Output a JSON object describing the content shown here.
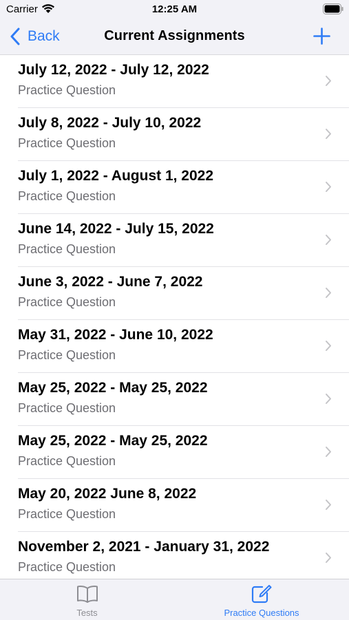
{
  "status_bar": {
    "carrier": "Carrier",
    "time": "12:25 AM",
    "wifi_icon": "wifi-icon",
    "battery_icon": "battery-full-icon"
  },
  "nav": {
    "back_label": "Back",
    "title": "Current Assignments",
    "add_icon": "plus-icon"
  },
  "colors": {
    "accent": "#2f7cf6",
    "secondary_text": "#6d6d72",
    "inactive_tab": "#8e8e93",
    "bar_background": "#f2f2f7"
  },
  "assignments": [
    {
      "title": "July 12, 2022 - July 12, 2022",
      "subtitle": "Practice Question"
    },
    {
      "title": "July 8, 2022 - July 10, 2022",
      "subtitle": "Practice Question"
    },
    {
      "title": "July 1, 2022 - August 1, 2022",
      "subtitle": "Practice Question"
    },
    {
      "title": "June 14, 2022 - July 15, 2022",
      "subtitle": "Practice Question"
    },
    {
      "title": "June 3, 2022 - June 7, 2022",
      "subtitle": "Practice Question"
    },
    {
      "title": "May 31, 2022 - June 10, 2022",
      "subtitle": "Practice Question"
    },
    {
      "title": "May 25, 2022 - May 25, 2022",
      "subtitle": "Practice Question"
    },
    {
      "title": "May 25, 2022 - May 25, 2022",
      "subtitle": "Practice Question"
    },
    {
      "title": "May 20, 2022 June 8, 2022",
      "subtitle": "Practice Question"
    },
    {
      "title": "November 2, 2021 - January 31, 2022",
      "subtitle": "Practice Question"
    }
  ],
  "tab_bar": {
    "tabs": [
      {
        "label": "Tests",
        "icon": "book-icon",
        "selected": false
      },
      {
        "label": "Practice Questions",
        "icon": "compose-icon",
        "selected": true
      }
    ]
  }
}
